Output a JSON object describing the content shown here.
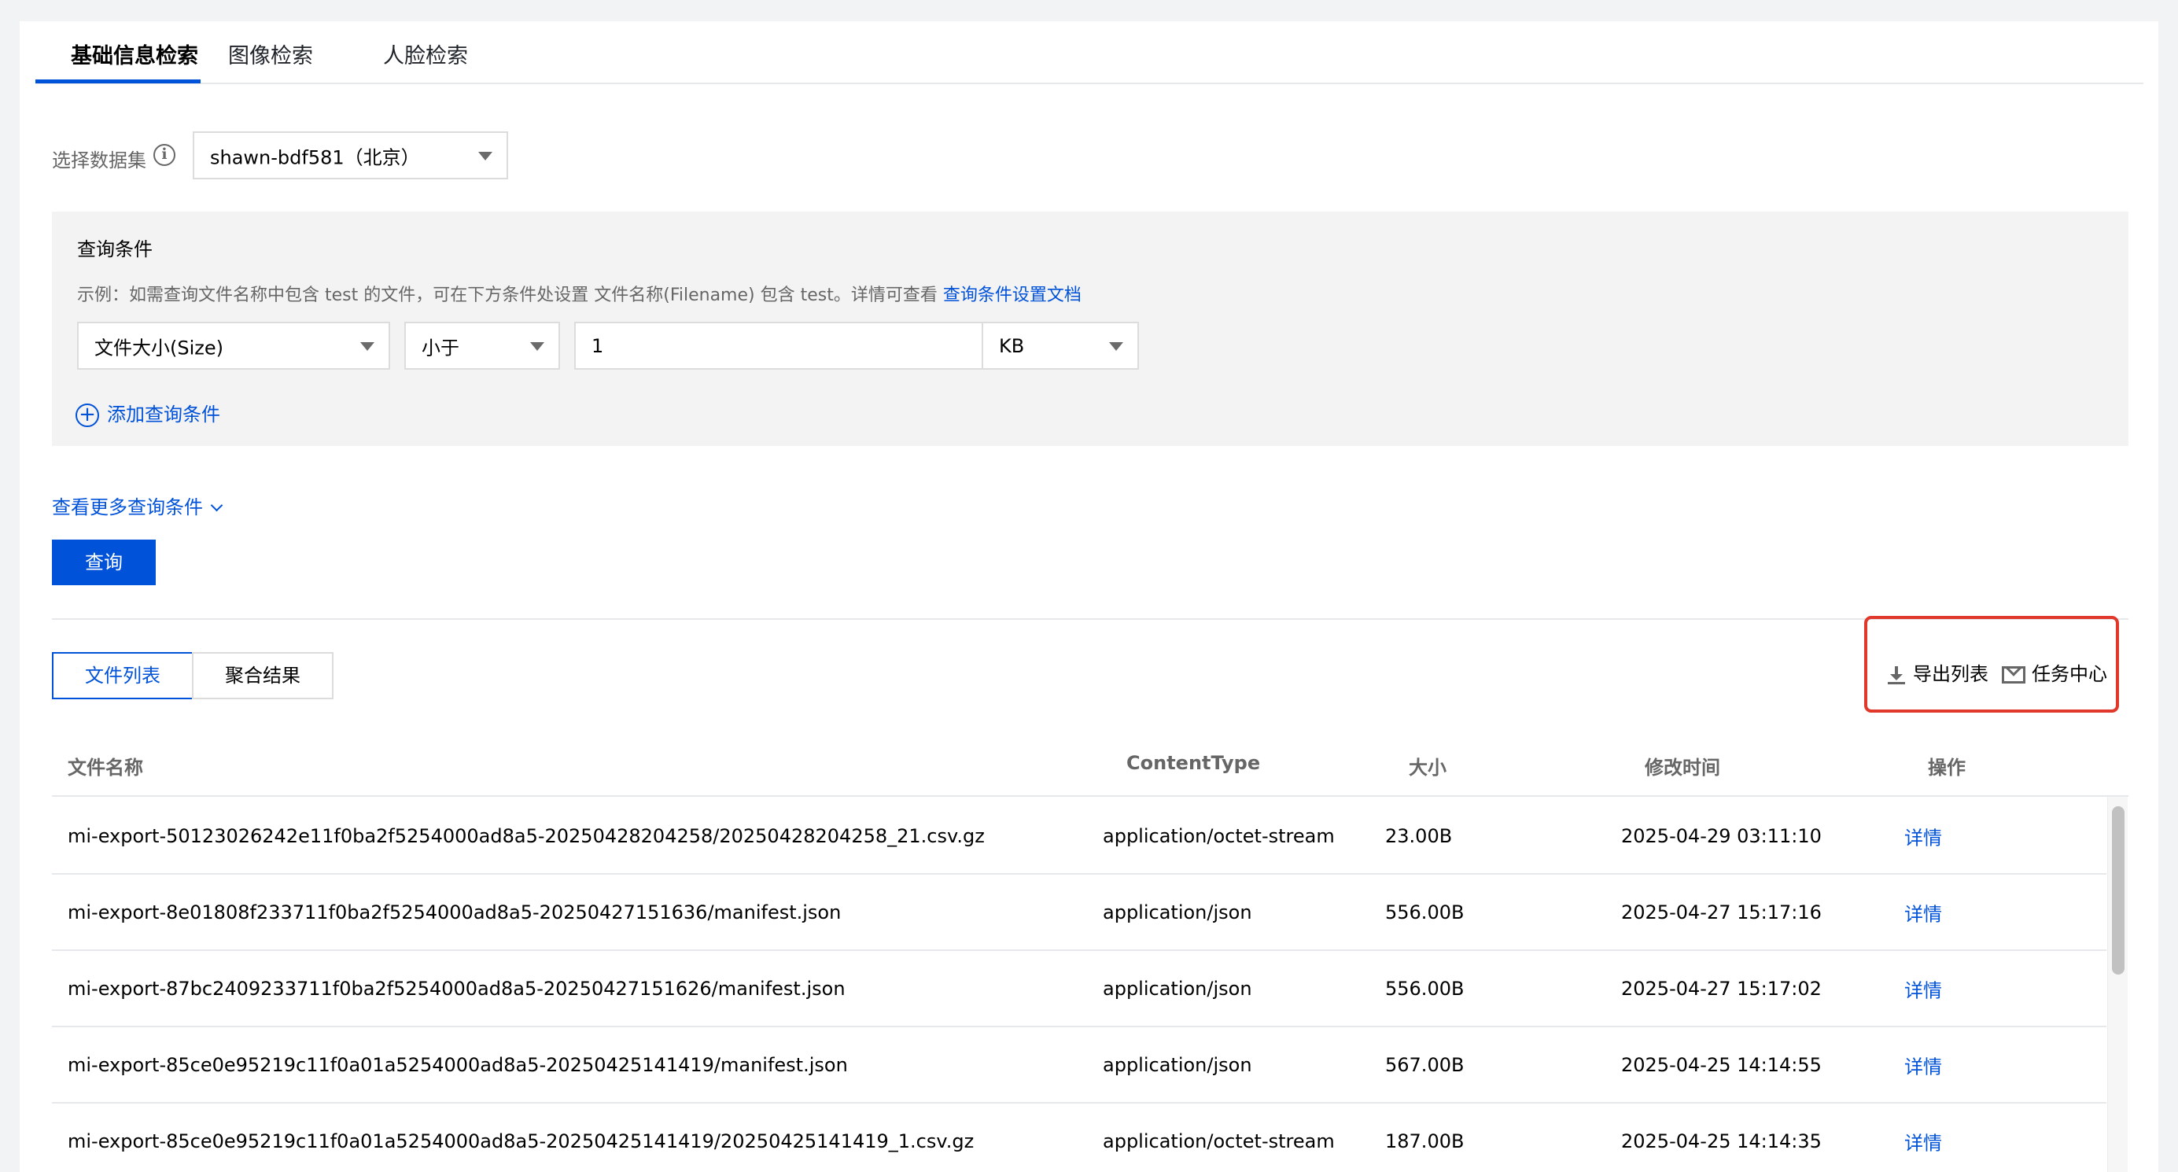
{
  "tabs": [
    "基础信息检索",
    "图像检索",
    "人脸检索"
  ],
  "dataset": {
    "label": "选择数据集",
    "info_icon": "i",
    "value": "shawn-bdf581（北京）"
  },
  "query": {
    "title": "查询条件",
    "hint_text": "示例：如需查询文件名称中包含 test 的文件，可在下方条件处设置 文件名称(Filename) 包含 test。详情可查看 ",
    "hint_link": "查询条件设置文档",
    "field": "文件大小(Size)",
    "operator": "小于",
    "value": "1",
    "unit": "KB",
    "add_condition": "添加查询条件",
    "more_conditions": "查看更多查询条件",
    "submit": "查询"
  },
  "result_tabs": [
    "文件列表",
    "聚合结果"
  ],
  "actions": {
    "export": "导出列表",
    "task_center": "任务中心"
  },
  "table": {
    "headers": [
      "文件名称",
      "ContentType",
      "大小",
      "修改时间",
      "操作"
    ],
    "rows": [
      [
        "mi-export-50123026242e11f0ba2f5254000ad8a5-20250428204258/20250428204258_21.csv.gz",
        "application/octet-stream",
        "23.00B",
        "2025-04-29 03:11:10",
        "详情"
      ],
      [
        "mi-export-8e01808f233711f0ba2f5254000ad8a5-20250427151636/manifest.json",
        "application/json",
        "556.00B",
        "2025-04-27 15:17:16",
        "详情"
      ],
      [
        "mi-export-87bc2409233711f0ba2f5254000ad8a5-20250427151626/manifest.json",
        "application/json",
        "556.00B",
        "2025-04-27 15:17:02",
        "详情"
      ],
      [
        "mi-export-85ce0e95219c11f0a01a5254000ad8a5-20250425141419/manifest.json",
        "application/json",
        "567.00B",
        "2025-04-25 14:14:55",
        "详情"
      ],
      [
        "mi-export-85ce0e95219c11f0a01a5254000ad8a5-20250425141419/20250425141419_1.csv.gz",
        "application/octet-stream",
        "187.00B",
        "2025-04-25 14:14:35",
        "详情"
      ]
    ]
  },
  "colors": {
    "accent": "#0052d9",
    "highlight_box": "#e0392b"
  }
}
